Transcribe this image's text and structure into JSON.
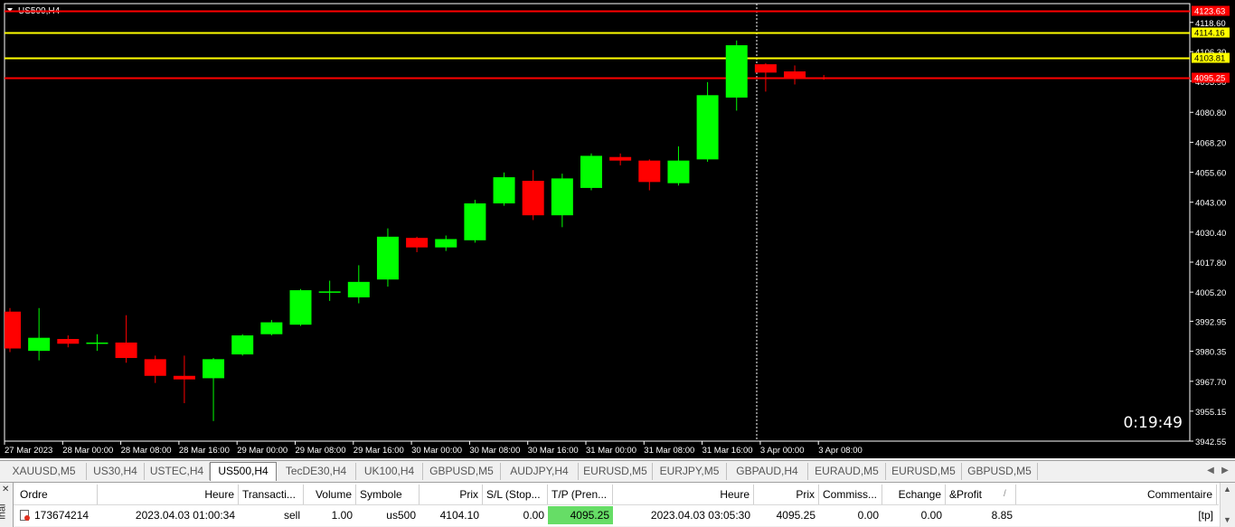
{
  "chart": {
    "symbol_label": "US500,H4",
    "price_min": 3942.55,
    "price_max": 4126.5,
    "price_labels": [
      "4118.60",
      "4106.30",
      "4093.90",
      "4080.80",
      "4068.20",
      "4055.60",
      "4043.00",
      "4030.40",
      "4017.80",
      "4005.20",
      "3992.95",
      "3980.35",
      "3967.70",
      "3955.15",
      "3942.55"
    ],
    "time_labels": [
      "27 Mar 2023",
      "28 Mar 00:00",
      "28 Mar 08:00",
      "28 Mar 16:00",
      "29 Mar 00:00",
      "29 Mar 08:00",
      "29 Mar 16:00",
      "30 Mar 00:00",
      "30 Mar 08:00",
      "30 Mar 16:00",
      "31 Mar 00:00",
      "31 Mar 08:00",
      "31 Mar 16:00",
      "3 Apr 00:00",
      "3 Apr 08:00"
    ],
    "bull_color": "#00ff00",
    "bear_color": "#ff0000",
    "candles": [
      {
        "o": 3997.0,
        "h": 3998.5,
        "l": 3980.0,
        "c": 3981.5
      },
      {
        "o": 3980.5,
        "h": 3998.5,
        "l": 3976.5,
        "c": 3986.0
      },
      {
        "o": 3985.5,
        "h": 3987.0,
        "l": 3982.0,
        "c": 3983.5
      },
      {
        "o": 3983.5,
        "h": 3987.5,
        "l": 3980.5,
        "c": 3984.0
      },
      {
        "o": 3984.0,
        "h": 3995.5,
        "l": 3975.5,
        "c": 3977.5
      },
      {
        "o": 3977.0,
        "h": 3978.5,
        "l": 3967.0,
        "c": 3970.0
      },
      {
        "o": 3970.0,
        "h": 3978.5,
        "l": 3958.5,
        "c": 3968.5
      },
      {
        "o": 3969.0,
        "h": 3977.5,
        "l": 3951.0,
        "c": 3977.0
      },
      {
        "o": 3979.0,
        "h": 3987.5,
        "l": 3978.5,
        "c": 3987.0
      },
      {
        "o": 3987.5,
        "h": 3993.5,
        "l": 3987.0,
        "c": 3992.5
      },
      {
        "o": 3991.5,
        "h": 4006.5,
        "l": 3991.0,
        "c": 4006.0
      },
      {
        "o": 4005.0,
        "h": 4010.0,
        "l": 4001.5,
        "c": 4005.5
      },
      {
        "o": 4003.0,
        "h": 4016.5,
        "l": 4000.5,
        "c": 4009.5
      },
      {
        "o": 4010.5,
        "h": 4032.0,
        "l": 4007.5,
        "c": 4028.5
      },
      {
        "o": 4028.0,
        "h": 4028.5,
        "l": 4022.0,
        "c": 4024.0
      },
      {
        "o": 4024.0,
        "h": 4029.0,
        "l": 4022.5,
        "c": 4027.5
      },
      {
        "o": 4027.0,
        "h": 4044.0,
        "l": 4026.0,
        "c": 4042.5
      },
      {
        "o": 4042.5,
        "h": 4055.5,
        "l": 4041.5,
        "c": 4053.5
      },
      {
        "o": 4052.0,
        "h": 4056.5,
        "l": 4035.5,
        "c": 4037.5
      },
      {
        "o": 4037.5,
        "h": 4055.0,
        "l": 4032.5,
        "c": 4053.0
      },
      {
        "o": 4049.0,
        "h": 4063.5,
        "l": 4048.0,
        "c": 4062.5
      },
      {
        "o": 4062.0,
        "h": 4063.5,
        "l": 4058.5,
        "c": 4060.5
      },
      {
        "o": 4060.5,
        "h": 4061.0,
        "l": 4048.0,
        "c": 4051.5
      },
      {
        "o": 4051.0,
        "h": 4066.5,
        "l": 4050.0,
        "c": 4060.5
      },
      {
        "o": 4061.0,
        "h": 4093.5,
        "l": 4060.0,
        "c": 4088.0
      },
      {
        "o": 4087.0,
        "h": 4111.0,
        "l": 4081.5,
        "c": 4109.0
      },
      {
        "o": 4101.0,
        "h": 4101.5,
        "l": 4089.5,
        "c": 4097.5
      },
      {
        "o": 4098.0,
        "h": 4100.5,
        "l": 4092.5,
        "c": 4095.5
      },
      {
        "o": 4095.5,
        "h": 4096.5,
        "l": 4094.5,
        "c": 4095.25
      }
    ],
    "hlines": [
      {
        "price": 4123.63,
        "color": "#ff0000",
        "label": "4123.63",
        "label_bg": "#ff0000",
        "label_color": "#ffffff"
      },
      {
        "price": 4114.16,
        "color": "#ffff00",
        "label": "4114.16",
        "label_bg": "#ffff00",
        "label_color": "#000000"
      },
      {
        "price": 4103.81,
        "color": "#ffff00",
        "label": "4103.81",
        "label_bg": "#ffff00",
        "label_color": "#000000"
      },
      {
        "price": 4095.25,
        "color": "#ff0000",
        "label": "4095.25",
        "label_bg": "#ff0000",
        "label_color": "#ffffff"
      }
    ],
    "timer": "0:19:49"
  },
  "tabs": [
    "XAUUSD,M5",
    "US30,H4",
    "USTEC,H4",
    "US500,H4",
    "TecDE30,H4",
    "UK100,H4",
    "GBPUSD,M5",
    "AUDJPY,H4",
    "EURUSD,M5",
    "EURJPY,M5",
    "GBPAUD,H4",
    "EURAUD,M5",
    "EURUSD,M5",
    "GBPUSD,M5"
  ],
  "active_tab": 3,
  "terminal": {
    "side_label": "inal",
    "headers": [
      "Ordre",
      "Heure",
      "Transacti...",
      "Volume",
      "Symbole",
      "Prix",
      "S/L (Stop...",
      "T/P (Pren...",
      "Heure",
      "Prix",
      "Commiss...",
      "Echange",
      "&Profit",
      "Commentaire"
    ],
    "sort_marker": "/",
    "row": [
      "173674214",
      "2023.04.03 01:00:34",
      "sell",
      "1.00",
      "us500",
      "4104.10",
      "0.00",
      "4095.25",
      "2023.04.03 03:05:30",
      "4095.25",
      "0.00",
      "0.00",
      "8.85",
      "[tp]"
    ],
    "tp_highlight": "#66dd66"
  }
}
